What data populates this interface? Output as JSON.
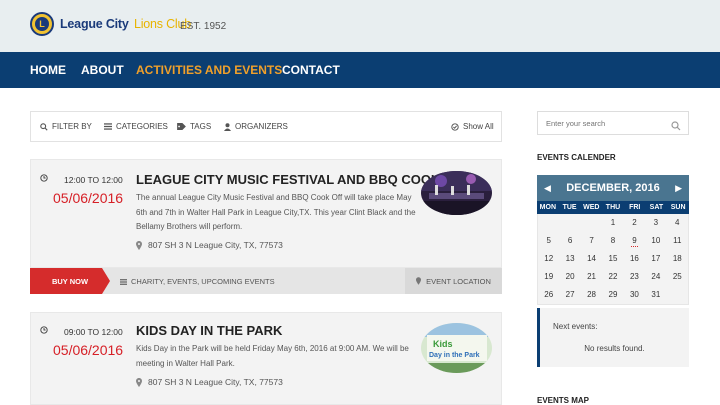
{
  "brand": {
    "name": "League City",
    "name_accent": "Lions Club",
    "emblem_letter": "L",
    "est": "EST. 1952"
  },
  "nav": {
    "items": [
      "HOME",
      "ABOUT",
      "ACTIVITIES AND EVENTS",
      "CONTACT"
    ],
    "active": "ACTIVITIES AND EVENTS"
  },
  "filters": {
    "filter_by": "FILTER BY",
    "categories": "CATEGORIES",
    "tags": "TAGS",
    "organizers": "ORGANIZERS",
    "show_all": "Show All"
  },
  "events": [
    {
      "time": "12:00 TO 12:00",
      "date": "05/06/2016",
      "title": "LEAGUE CITY MUSIC FESTIVAL AND BBQ COOK OFF",
      "description": "The annual League City Music Festival and BBQ Cook Off will take place May 6th and 7th in Walter Hall Park in League City,TX. This year Clint Black and the Bellamy Brothers will perform.",
      "address": "807 SH 3 N League City, TX, 77573",
      "buy_label": "BUY NOW",
      "tags": "CHARITY, EVENTS, UPCOMING EVENTS",
      "location_label": "EVENT LOCATION"
    },
    {
      "time": "09:00 TO 12:00",
      "date": "05/06/2016",
      "title": "KIDS DAY IN THE PARK",
      "description": "Kids Day in the Park will be held Friday May 6th, 2016 at 9:00 AM. We will be meeting in Walter Hall Park.",
      "address": "807 SH 3 N League City, TX, 77573",
      "thumb_caption": "Kids Day in the Park"
    }
  ],
  "sidebar": {
    "search_placeholder": "Enter your search",
    "calendar_heading": "EVENTS CALENDER",
    "calendar": {
      "month": "DECEMBER, 2016",
      "weekdays": [
        "MON",
        "TUE",
        "WED",
        "THU",
        "FRI",
        "SAT",
        "SUN"
      ],
      "weeks": [
        [
          "",
          "",
          "",
          "1",
          "2",
          "3",
          "4"
        ],
        [
          "5",
          "6",
          "7",
          "8",
          "9",
          "10",
          "11"
        ],
        [
          "12",
          "13",
          "14",
          "15",
          "16",
          "17",
          "18"
        ],
        [
          "19",
          "20",
          "21",
          "22",
          "23",
          "24",
          "25"
        ],
        [
          "26",
          "27",
          "28",
          "29",
          "30",
          "31",
          ""
        ]
      ],
      "event_day": "9"
    },
    "next_events_label": "Next events:",
    "no_results": "No results found.",
    "map_heading": "EVENTS MAP"
  },
  "colors": {
    "nav_bg": "#0b3e72",
    "accent_orange": "#f0a02a",
    "date_red": "#d61f26",
    "buy_red": "#d52c2c",
    "calendar_head": "#4a7590"
  }
}
